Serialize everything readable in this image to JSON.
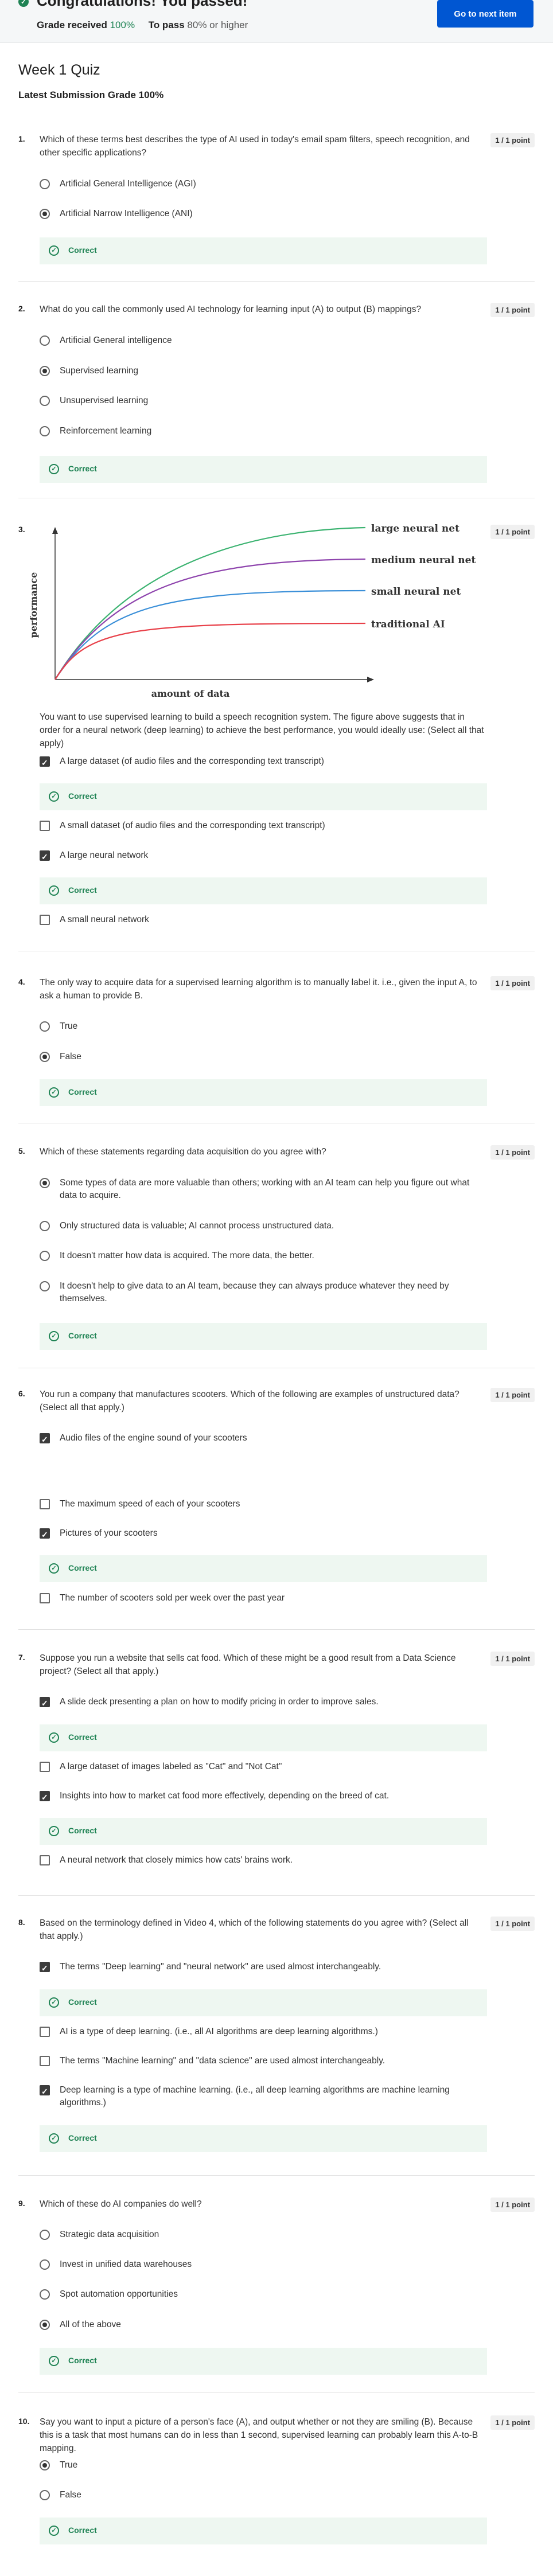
{
  "banner": {
    "title": "Congratulations! You passed!",
    "grade_received_label": "Grade received",
    "grade_received_value": "100%",
    "to_pass_label": "To pass",
    "to_pass_value": "80% or higher",
    "next_button": "Go to next item",
    "colors": {
      "success": "#1f8354",
      "primary": "#0056d2"
    }
  },
  "quiz": {
    "title": "Week 1 Quiz",
    "latest_grade": "Latest Submission Grade 100%"
  },
  "feedback_label": "Correct",
  "questions": [
    {
      "num": "1.",
      "points": "1 / 1 point",
      "text": "Which of these terms best describes the type of AI used in today's email spam filters, speech recognition, and other specific applications?",
      "options": [
        "Artificial General Intelligence (AGI)",
        "Artificial Narrow Intelligence (ANI)"
      ]
    },
    {
      "num": "2.",
      "points": "1 / 1 point",
      "text": "What do you call the commonly used AI technology for learning input (A) to output (B) mappings?",
      "options": [
        "Artificial General intelligence",
        "Supervised learning",
        "Unsupervised learning",
        "Reinforcement learning"
      ]
    },
    {
      "num": "3.",
      "points": "1 / 1 point",
      "text": "You want to use supervised learning to build a speech recognition system. The figure above suggests that in order for a neural network (deep learning) to achieve the best performance, you would ideally use: (Select all that apply)",
      "options": [
        "A large dataset (of audio files and the corresponding text transcript)",
        "A small dataset (of audio files and the corresponding text transcript)",
        "A large neural network",
        "A small neural network"
      ]
    },
    {
      "num": "4.",
      "points": "1 / 1 point",
      "text": "The only way to acquire data for a supervised learning algorithm is to manually label it. i.e., given the input A, to ask a human to provide B.",
      "options": [
        "True",
        "False"
      ]
    },
    {
      "num": "5.",
      "points": "1 / 1 point",
      "text": "Which of these statements regarding data acquisition do you agree with?",
      "options": [
        "Some types of data are more valuable than others; working with an AI team can help you figure out what data to acquire.",
        "Only structured data is valuable; AI cannot process unstructured data.",
        "It doesn't matter how data is acquired. The more data, the better.",
        "It doesn't help to give data to an AI team, because they can always produce whatever they need by themselves."
      ]
    },
    {
      "num": "6.",
      "points": "1 / 1 point",
      "text": "You run a company that manufactures scooters. Which of the following are examples of unstructured data? (Select all that apply.)",
      "options": [
        "Audio files of the engine sound of your scooters",
        "The maximum speed of each of your scooters",
        "Pictures of your scooters",
        "The number of scooters sold per week over the past year"
      ]
    },
    {
      "num": "7.",
      "points": "1 / 1 point",
      "text": "Suppose you run a website that sells cat food. Which of these might be a good result from a Data Science project? (Select all that apply.)",
      "options": [
        "A slide deck presenting a plan on how to modify pricing in order to improve sales.",
        "A large dataset of images labeled as \"Cat\" and \"Not Cat\"",
        "Insights into how to market cat food more effectively, depending on the breed of cat.",
        "A neural network that closely mimics how cats' brains work."
      ]
    },
    {
      "num": "8.",
      "points": "1 / 1 point",
      "text": "Based on the terminology defined in Video 4, which of the following statements do you agree with? (Select all that apply.)",
      "options": [
        "The terms \"Deep learning\" and \"neural network\" are used almost interchangeably.",
        "AI is a type of deep learning. (i.e., all AI algorithms are deep learning algorithms.)",
        "The terms \"Machine learning\" and \"data science\" are used almost interchangeably.",
        "Deep learning is a type of machine learning. (i.e., all deep learning algorithms are machine learning algorithms.)"
      ]
    },
    {
      "num": "9.",
      "points": "1 / 1 point",
      "text": "Which of these do AI companies do well?",
      "options": [
        "Strategic data acquisition",
        "Invest in unified data warehouses",
        "Spot automation opportunities",
        "All of the above"
      ]
    },
    {
      "num": "10.",
      "points": "1 / 1 point",
      "text": "Say you want to input a picture of a person's face (A), and output whether or not they are smiling (B). Because this is a task that most humans can do in less than 1 second, supervised learning can probably learn this A-to-B mapping.",
      "options": [
        "True",
        "False"
      ]
    }
  ],
  "figure": {
    "ylabel": "performance",
    "xlabel": "amount of data",
    "series": [
      {
        "name": "large neural net",
        "color": "#3cb371"
      },
      {
        "name": "medium neural net",
        "color": "#8e44ad"
      },
      {
        "name": "small neural net",
        "color": "#3a8fd8"
      },
      {
        "name": "traditional AI",
        "color": "#e8414a"
      }
    ]
  }
}
